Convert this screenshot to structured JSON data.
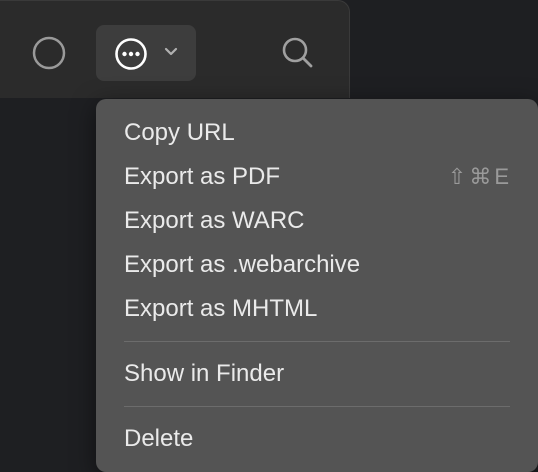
{
  "toolbar": {
    "circle_button_icon": "circle-icon",
    "more_button_icon": "ellipsis-circle-icon",
    "more_button_chevron": "chevron-down-icon",
    "search_icon": "search-icon"
  },
  "menu": {
    "items": [
      {
        "label": "Copy URL",
        "shortcut": ""
      },
      {
        "label": "Export as PDF",
        "shortcut": "⇧⌘E"
      },
      {
        "label": "Export as WARC",
        "shortcut": ""
      },
      {
        "label": "Export as .webarchive",
        "shortcut": ""
      },
      {
        "label": "Export as MHTML",
        "shortcut": ""
      },
      {
        "label": "Show in Finder",
        "shortcut": ""
      },
      {
        "label": "Delete",
        "shortcut": ""
      }
    ]
  },
  "colors": {
    "background": "#1e1f22",
    "toolbar": "#2b2b2b",
    "menu": "#545454",
    "menu_text": "#eaeaea",
    "shortcut_text": "#9a9a9a"
  }
}
